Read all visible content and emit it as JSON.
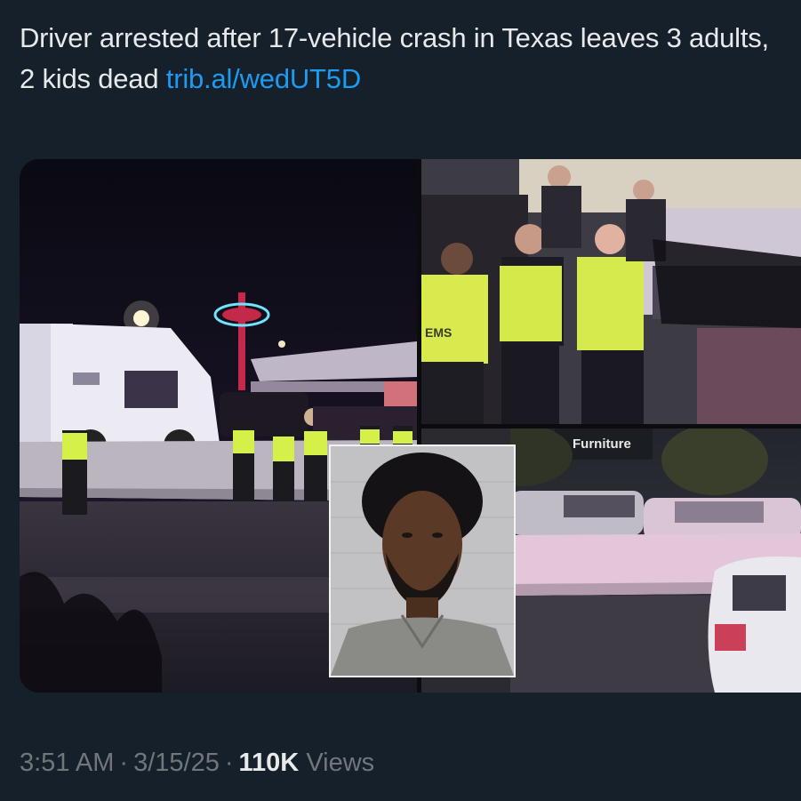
{
  "tweet": {
    "text": "Driver arrested after 17-vehicle crash in Texas leaves 3 adults, 2 kids dead",
    "link_text": "trib.al/wedUT5D"
  },
  "media": {
    "top_right_sign": "EMS",
    "bottom_right_sign": "Furniture"
  },
  "meta": {
    "time": "3:51 AM",
    "date": "3/15/25",
    "views_count": "110K",
    "views_label": "Views",
    "separator": "·"
  },
  "colors": {
    "background": "#15202b",
    "text": "#e7e9ea",
    "link": "#1d9bf0",
    "muted": "#71767b"
  }
}
